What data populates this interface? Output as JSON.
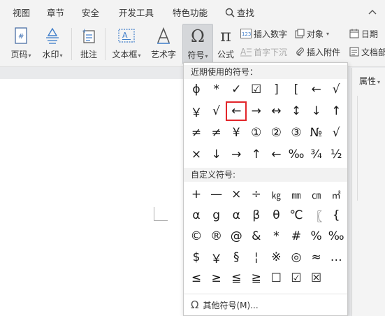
{
  "menubar": {
    "items": [
      "视图",
      "章节",
      "安全",
      "开发工具",
      "特色功能"
    ],
    "search_label": "查找",
    "collapse_icon": "chevron-up-icon"
  },
  "ribbon": {
    "page_number_label": "页码",
    "watermark_label": "水印",
    "comment_label": "批注",
    "textbox_label": "文本框",
    "wordart_label": "艺术字",
    "symbol_label": "符号",
    "formula_label": "公式",
    "insert_number_label": "插入数字",
    "object_label": "对象",
    "date_label": "日期",
    "dropcap_label": "首字下沉",
    "attachment_label": "插入附件",
    "doc_parts_label": "文档部"
  },
  "side_panel": {
    "properties_label": "属性"
  },
  "symbol_dropdown": {
    "recent_header": "近期使用的符号：",
    "custom_header": "自定义符号:",
    "recent_symbols": [
      [
        "ϕ",
        "*",
        "✓",
        "☑",
        "]",
        "[",
        "←",
        "√"
      ],
      [
        "￥",
        "√",
        "←",
        "→",
        "↔",
        "↕",
        "↓",
        "↑"
      ],
      [
        "≠",
        "≠",
        "¥",
        "①",
        "②",
        "③",
        "№",
        "√"
      ],
      [
        "×",
        "↓",
        "→",
        "↑",
        "←",
        "‰",
        "¾",
        "½"
      ]
    ],
    "custom_symbols": [
      [
        "+",
        "—",
        "×",
        "÷",
        "㎏",
        "㎜",
        "㎝",
        "㎡"
      ],
      [
        "α",
        "g",
        "α",
        "β",
        "θ",
        "℃",
        "〖",
        "{"
      ],
      [
        "©",
        "®",
        "@",
        "&",
        "*",
        "#",
        "%",
        "‰"
      ],
      [
        "$",
        "￥",
        "§",
        "¦",
        "※",
        "◎",
        "≈",
        "…"
      ],
      [
        "≤",
        "≥",
        "≦",
        "≧",
        "☐",
        "☑",
        "☒",
        ""
      ]
    ],
    "selected_symbol": "←",
    "more_label": "其他符号(M)..."
  }
}
